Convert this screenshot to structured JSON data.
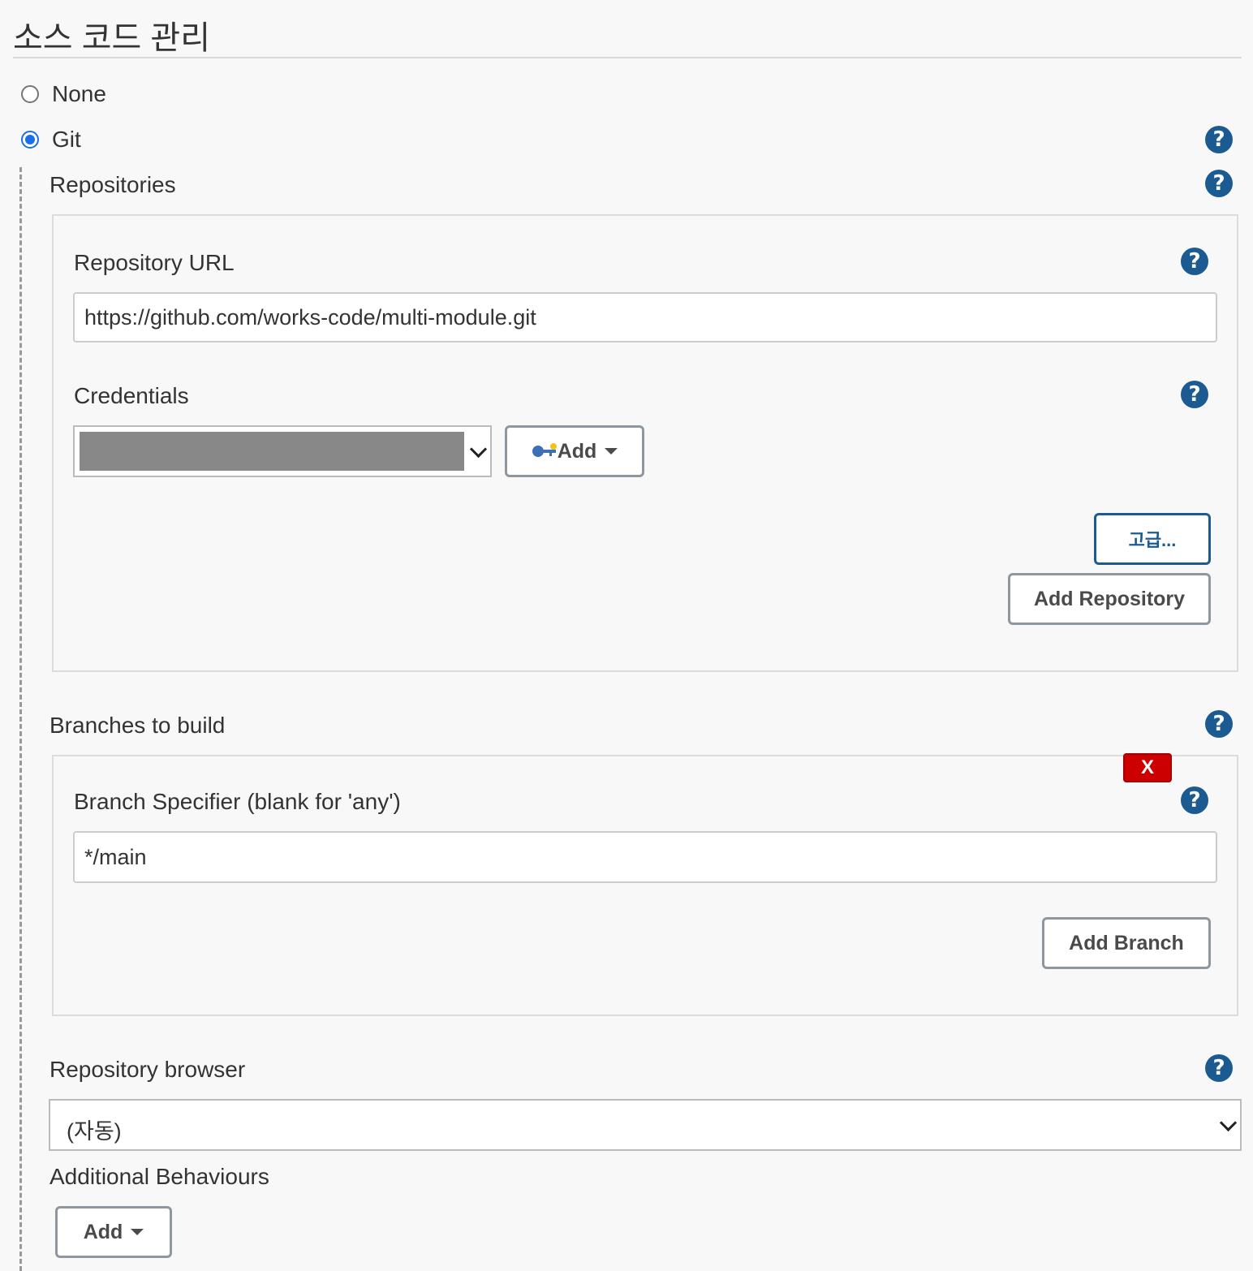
{
  "section": {
    "title": "소스 코드 관리"
  },
  "scm": {
    "options": [
      {
        "label": "None",
        "checked": false
      },
      {
        "label": "Git",
        "checked": true
      }
    ]
  },
  "git": {
    "repositories": {
      "label": "Repositories",
      "url_label": "Repository URL",
      "url_value": "https://github.com/works-code/multi-module.git",
      "credentials_label": "Credentials",
      "credentials_add_label": "Add",
      "advanced_label": "고급...",
      "add_repository_label": "Add Repository"
    },
    "branches": {
      "label": "Branches to build",
      "delete_label": "X",
      "specifier_label": "Branch Specifier (blank for 'any')",
      "specifier_value": "*/main",
      "add_branch_label": "Add Branch"
    },
    "browser": {
      "label": "Repository browser",
      "selected": "(자동)"
    },
    "behaviours": {
      "label": "Additional Behaviours",
      "add_label": "Add"
    }
  },
  "colors": {
    "accent": "#1b5b91",
    "radio_checked": "#1a6fe8",
    "delete": "#cc0000",
    "background": "#f8f8f8"
  },
  "icons": {
    "help": "help-icon",
    "credentials_add": "key-icon",
    "dropdown": "chevron-down-icon"
  }
}
